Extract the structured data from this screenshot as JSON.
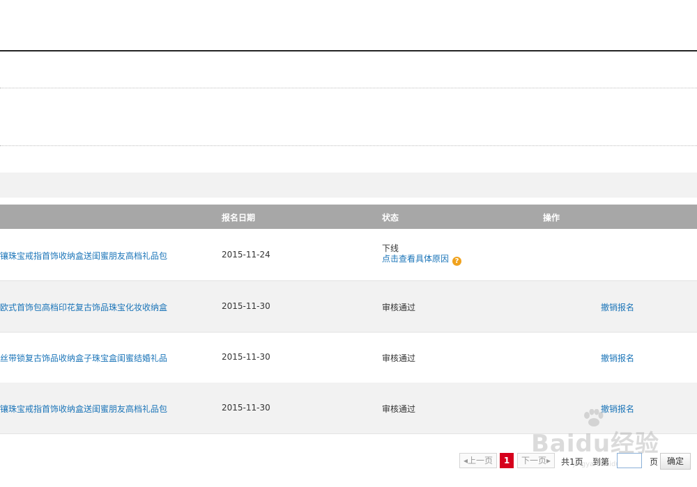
{
  "table": {
    "headers": {
      "date": "报名日期",
      "status": "状态",
      "ops": "操作"
    },
    "rows": [
      {
        "product": "镶珠宝戒指首饰收纳盒送闺蜜朋友高档礼品包",
        "date": "2015-11-24",
        "status": "下线",
        "reason": "点击查看具体原因",
        "action": ""
      },
      {
        "product": "欧式首饰包高档印花复古饰品珠宝化妆收纳盒",
        "date": "2015-11-30",
        "status": "审核通过",
        "reason": "",
        "action": "撤销报名"
      },
      {
        "product": "丝带锁复古饰品收纳盒子珠宝盒闺蜜结婚礼品",
        "date": "2015-11-30",
        "status": "审核通过",
        "reason": "",
        "action": "撤销报名"
      },
      {
        "product": "镶珠宝戒指首饰收纳盒送闺蜜朋友高档礼品包",
        "date": "2015-11-30",
        "status": "审核通过",
        "reason": "",
        "action": "撤销报名"
      }
    ]
  },
  "pager": {
    "prev": "◂上一页",
    "current": "1",
    "next": "下一页▸",
    "total": "共1页",
    "goto": "到第",
    "unit": "页",
    "confirm": "确定",
    "input_value": ""
  },
  "watermark": {
    "text": "Baidu经验",
    "sub": "jingyan.baidu.com"
  },
  "colors": {
    "link": "#1a74b8",
    "header_bg": "#a7a7a7",
    "current_page": "#d6001c",
    "help": "#f0a21d"
  }
}
